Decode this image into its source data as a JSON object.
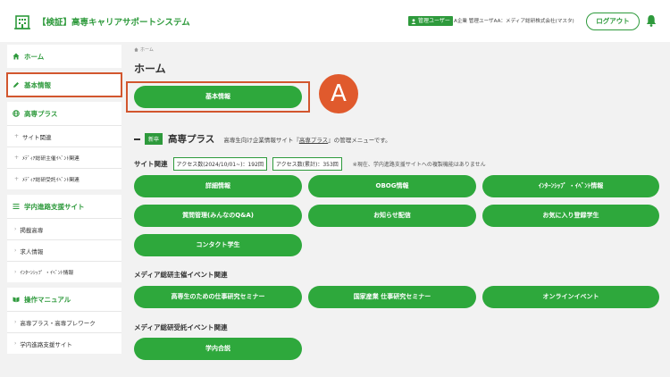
{
  "header": {
    "title": "【検証】高専キャリアサポートシステム",
    "role_badge": "管理ユーザー",
    "user_name": "A企業 管理ユーザAA：メディア総研株式会社(マスタ)",
    "logout_label": "ログアウト",
    "icons": [
      "building-icon",
      "user-icon",
      "bell-icon"
    ]
  },
  "sidebar": {
    "home": "ホーム",
    "basic_info": "基本情報",
    "kosen_plus": {
      "title": "高専プラス",
      "items": [
        "サイト関連",
        "ﾒﾃﾞｨｱ総研主催ｲﾍﾞﾝﾄ関連",
        "ﾒﾃﾞｨｱ総研受託ｲﾍﾞﾝﾄ関連"
      ]
    },
    "school_site": {
      "title": "学内進路支援サイト",
      "items": [
        "掲載高専",
        "求人情報",
        "ｲﾝﾀｰﾝｼｯﾌﾟ ・ｲﾍﾞﾝﾄ情報"
      ]
    },
    "manual": {
      "title": "操作マニュアル",
      "items": [
        "高専プラス・高専プレワーク",
        "学内進路支援サイト"
      ]
    }
  },
  "main": {
    "breadcrumb": "ホーム",
    "page_title": "ホーム",
    "basic_info_button": "基本情報",
    "marker_letter": "A",
    "section": {
      "badge": "新卒",
      "name": "高専プラス",
      "desc_prefix": "高専生向け企業情報サイト『",
      "desc_link": "高専プラス",
      "desc_suffix": "』の管理メニューです。"
    },
    "site": {
      "label": "サイト関連",
      "access_year": "アクセス数(2024/10/01~)：192回",
      "access_total": "アクセス数(累計)：353回",
      "note": "※現在、学内進路支援サイトへの複製機能はありません",
      "buttons": [
        "詳細情報",
        "OBOG情報",
        "ｲﾝﾀｰﾝｼｯﾌﾟ ・ｲﾍﾞﾝﾄ情報",
        "質問管理(みんなのQ&A)",
        "お知らせ配信",
        "お気に入り登録学生",
        "コンタクト学生"
      ]
    },
    "hosted": {
      "title": "メディア総研主催イベント関連",
      "buttons": [
        "高専生のための仕事研究セミナー",
        "国家産業 仕事研究セミナー",
        "オンラインイベント"
      ]
    },
    "consigned": {
      "title": "メディア総研受託イベント関連",
      "buttons": [
        "学内合説"
      ]
    }
  },
  "colors": {
    "brand_green": "#2e9a3c",
    "button_green": "#2ea83c",
    "highlight_orange": "#d2562e",
    "marker_orange": "#e05a2d"
  }
}
